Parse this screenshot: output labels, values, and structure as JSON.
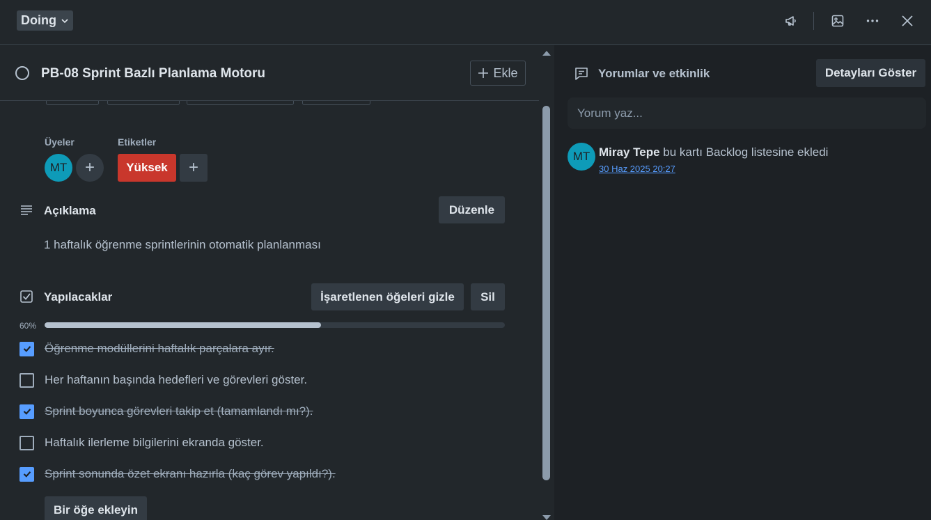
{
  "header": {
    "list_name": "Doing",
    "icons": [
      "megaphone-icon",
      "image-icon",
      "more-icon",
      "close-icon"
    ]
  },
  "card": {
    "title": "PB-08 Sprint Bazlı Planlama Motoru",
    "add_label": "Ekle"
  },
  "members": {
    "label": "Üyeler",
    "avatar_initials": "MT",
    "add_symbol": "+"
  },
  "labels": {
    "label": "Etiketler",
    "chip_text": "Yüksek",
    "chip_color": "#c9372c",
    "add_symbol": "+"
  },
  "description": {
    "title": "Açıklama",
    "edit_label": "Düzenle",
    "text": "1 haftalık öğrenme sprintlerinin otomatik planlanması"
  },
  "checklist": {
    "title": "Yapılacaklar",
    "hide_checked_label": "İşaretlenen öğeleri gizle",
    "delete_label": "Sil",
    "progress_text": "60%",
    "progress_value": 0.6,
    "items": [
      {
        "text": "Öğrenme modüllerini haftalık parçalara ayır.",
        "checked": true
      },
      {
        "text": "Her haftanın başında hedefleri ve görevleri göster.",
        "checked": false
      },
      {
        "text": "Sprint boyunca görevleri takip et (tamamlandı mı?).",
        "checked": true
      },
      {
        "text": "Haftalık ilerleme bilgilerini ekranda göster.",
        "checked": false
      },
      {
        "text": "Sprint sonunda özet ekranı hazırla (kaç görev yapıldı?).",
        "checked": true
      }
    ],
    "add_item_label": "Bir öğe ekleyin"
  },
  "activity": {
    "title": "Yorumlar ve etkinlik",
    "details_label": "Detayları Göster",
    "comment_placeholder": "Yorum yaz...",
    "entries": [
      {
        "initials": "MT",
        "user": "Miray Tepe",
        "action": " bu kartı Backlog listesine ekledi",
        "time": "30 Haz 2025 20:27"
      }
    ]
  },
  "colors": {
    "accent": "#579dff",
    "avatar": "#0e9bb8",
    "background": "#22272b",
    "panel": "#1d2125"
  }
}
